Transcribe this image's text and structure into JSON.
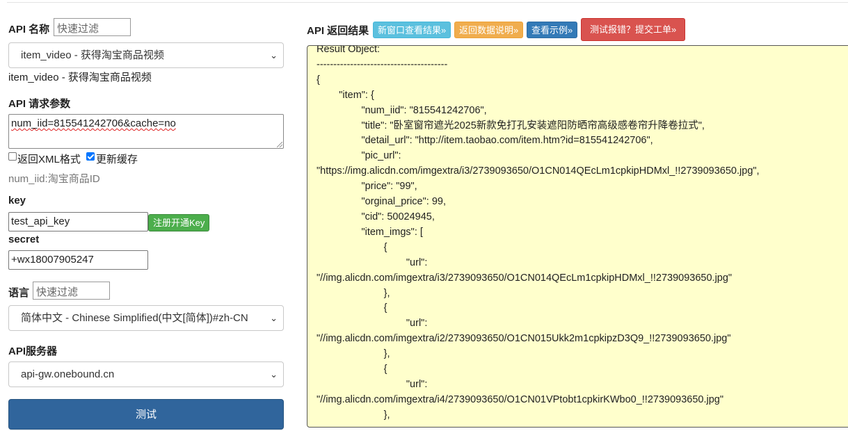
{
  "left": {
    "api_name_label": "API 名称",
    "api_name_filter_placeholder": "快速过滤",
    "api_select_value": "item_video - 获得淘宝商品视频",
    "api_selected_text": "item_video - 获得淘宝商品视频",
    "params_label": "API 请求参数",
    "params_value": "num_iid=815541242706&cache=no",
    "xml_checkbox_label": "返回XML格式",
    "xml_checked": false,
    "cache_checkbox_label": "更新缓存",
    "cache_checked": true,
    "param_hint": "num_iid:淘宝商品ID",
    "key_label": "key",
    "key_value": "test_api_key",
    "register_button": "注册开通Key",
    "secret_label": "secret",
    "secret_value": "+wx18007905247",
    "lang_label": "语言",
    "lang_filter_placeholder": "快速过滤",
    "lang_select_value": "简体中文 - Chinese Simplified(中文[简体])#zh-CN",
    "server_label": "API服务器",
    "server_select_value": "api-gw.onebound.cn",
    "test_button": "测试"
  },
  "right": {
    "result_label": "API 返回结果",
    "btn_new_window": "新窗口查看结果»",
    "btn_data_desc": "返回数据说明»",
    "btn_example": "查看示例»",
    "btn_report": "测试报错？提交工单»",
    "result_text": "Result Object:\n---------------------------------------\n{\n        \"item\": {\n                \"num_iid\": \"815541242706\",\n                \"title\": \"卧室窗帘遮光2025新款免打孔安装遮阳防晒帘高级感卷帘升降卷拉式\",\n                \"detail_url\": \"http://item.taobao.com/item.htm?id=815541242706\",\n                \"pic_url\":\n\"https://img.alicdn.com/imgextra/i3/2739093650/O1CN014QEcLm1cpkipHDMxl_!!2739093650.jpg\",\n                \"price\": \"99\",\n                \"orginal_price\": 99,\n                \"cid\": 50024945,\n                \"item_imgs\": [\n                        {\n                                \"url\":\n\"//img.alicdn.com/imgextra/i3/2739093650/O1CN014QEcLm1cpkipHDMxl_!!2739093650.jpg\"\n                        },\n                        {\n                                \"url\":\n\"//img.alicdn.com/imgextra/i2/2739093650/O1CN015Ukk2m1cpkipzD3Q9_!!2739093650.jpg\"\n                        },\n                        {\n                                \"url\":\n\"//img.alicdn.com/imgextra/i4/2739093650/O1CN01VPtobt1cpkirKWbo0_!!2739093650.jpg\"\n                        },"
  }
}
